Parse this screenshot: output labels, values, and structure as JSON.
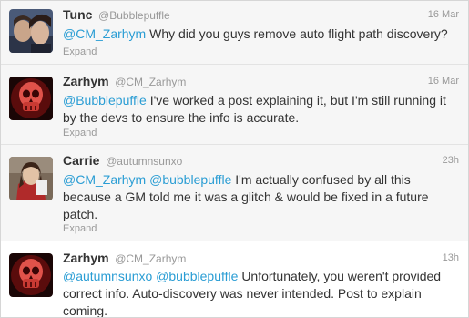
{
  "tweets": [
    {
      "name": "Tunc",
      "handle": "@Bubblepuffle",
      "time": "16 Mar",
      "mentions": [
        "@CM_Zarhym"
      ],
      "text": "Why did you guys remove auto flight path discovery?",
      "expand": "Expand"
    },
    {
      "name": "Zarhym",
      "handle": "@CM_Zarhym",
      "time": "16 Mar",
      "mentions": [
        "@Bubblepuffle"
      ],
      "text": "I've worked a post explaining it, but I'm still running it by the devs to ensure the info is accurate.",
      "expand": "Expand"
    },
    {
      "name": "Carrie",
      "handle": "@autumnsunxo",
      "time": "23h",
      "mentions": [
        "@CM_Zarhym",
        "@bubblepuffle"
      ],
      "text": "I'm actually confused by all this because a GM told me it was a glitch & would be fixed in a future patch.",
      "expand": "Expand"
    },
    {
      "name": "Zarhym",
      "handle": "@CM_Zarhym",
      "time": "13h",
      "mentions": [
        "@autumnsunxo",
        "@bubblepuffle"
      ],
      "text": "Unfortunately, you weren't provided correct info. Auto-discovery was never intended. Post to explain coming."
    }
  ],
  "colors": {
    "link": "#2a9dd4",
    "meta": "#999999",
    "text": "#333333",
    "shaded_row": "#f6f6f6"
  },
  "icons": [
    "avatar-photo-icon",
    "skull-avatar-icon",
    "avatar-photo-icon",
    "skull-avatar-icon"
  ]
}
